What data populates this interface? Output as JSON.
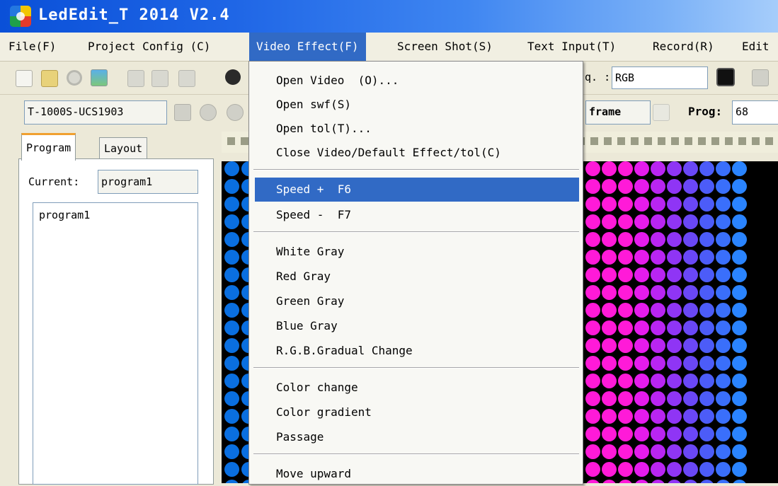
{
  "window": {
    "title": "LedEdit_T 2014 V2.4"
  },
  "menubar": [
    {
      "label": "File(F)"
    },
    {
      "label": "Project Config (C)"
    },
    {
      "label": "Video Effect(F)"
    },
    {
      "label": "Screen Shot(S)"
    },
    {
      "label": "Text Input(T)"
    },
    {
      "label": "Record(R)"
    },
    {
      "label": "Edit"
    }
  ],
  "toolbar": {
    "freq_label": "q. :",
    "freq_value": "RGB",
    "controller": "T-1000S-UCS1903",
    "frame_label": "frame",
    "prog_label": "Prog:",
    "prog_value": "68"
  },
  "sidebar": {
    "tabs": [
      {
        "label": "Program"
      },
      {
        "label": "Layout"
      }
    ],
    "current_label": "Current:",
    "current_value": "program1",
    "programs": [
      "program1"
    ]
  },
  "video_effect_menu": {
    "items": [
      {
        "label": "Open Video  (O)..."
      },
      {
        "label": "Open swf(S)"
      },
      {
        "label": "Open tol(T)..."
      },
      {
        "label": "Close Video/Default Effect/tol(C)"
      },
      {
        "label": "Speed +  F6"
      },
      {
        "label": "Speed -  F7"
      },
      {
        "label": "White Gray"
      },
      {
        "label": "Red Gray"
      },
      {
        "label": "Green Gray"
      },
      {
        "label": "Blue Gray"
      },
      {
        "label": "R.G.B.Gradual Change"
      },
      {
        "label": "Color change"
      },
      {
        "label": "Color gradient"
      },
      {
        "label": "Passage"
      },
      {
        "label": "Move upward"
      }
    ],
    "highlighted": "Speed +  F6"
  },
  "colors": {
    "menu_highlight": "#316ac5",
    "titlebar": "#0a50d8",
    "led_left": "#0a6fe0",
    "led_magenta": "#ff1ad8",
    "led_violet": "#8a2be2",
    "led_blue": "#1e6cff"
  }
}
